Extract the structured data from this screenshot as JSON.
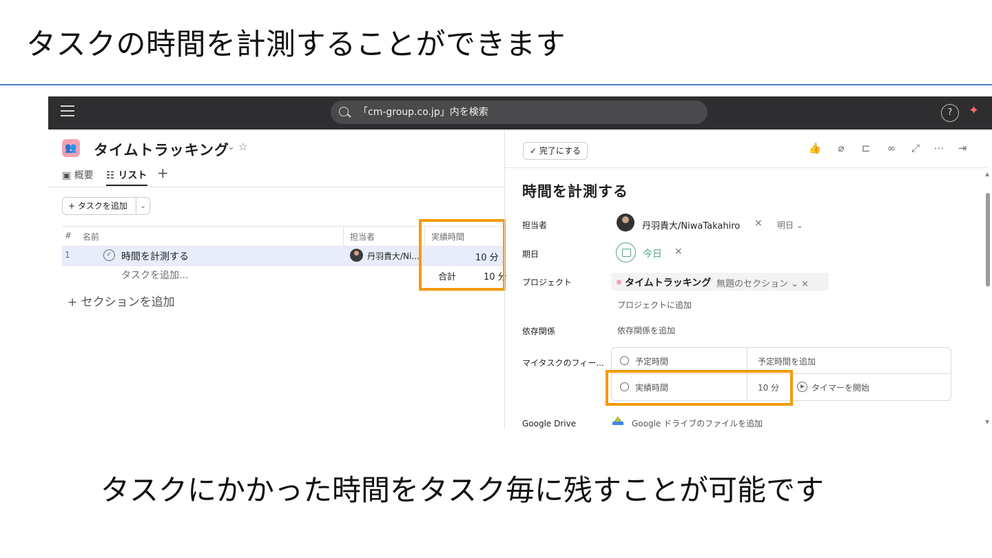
{
  "slide": {
    "title": "タスクの時間を計測することができます",
    "caption": "タスクにかかった時間をタスク毎に残すことが可能です"
  },
  "topbar": {
    "search_text": "「cm-group.co.jp」内を検索",
    "help_label": "?",
    "ai_icon": "sparkle-icon"
  },
  "project": {
    "icon_glyph": "👥",
    "name": "タイムトラッキング",
    "chevron": "⌄",
    "star": "☆",
    "tabs": [
      {
        "label": "概要",
        "icon": "overview-icon"
      },
      {
        "label": "リスト",
        "icon": "list-icon"
      }
    ],
    "tab_add": "+",
    "add_task_button": "+ タスクを追加",
    "add_task_dropdown": "⌄"
  },
  "list": {
    "columns": {
      "num": "#",
      "name": "名前",
      "assignee": "担当者",
      "actual_time": "実績時間"
    },
    "rows": [
      {
        "num": "1",
        "name": "時間を計測する",
        "assignee": "丹羽貴大/Ni...",
        "actual_time": "10 分"
      }
    ],
    "add_task_row": "タスクを追加...",
    "total_label": "合計",
    "total_value": "10 分",
    "add_section": "+ セクションを追加"
  },
  "detail": {
    "complete_button": "✓ 完了にする",
    "toolbar_icons": [
      "like-icon",
      "attachment-icon",
      "subtask-icon",
      "link-icon",
      "expand-icon",
      "more-icon",
      "close-pane-icon"
    ],
    "title": "時間を計測する",
    "fields": {
      "assignee_label": "担当者",
      "assignee_value": "丹羽貴大/NiwaTakahiro",
      "assignee_x": "×",
      "assignee_due": "明日 ⌄",
      "due_label": "期日",
      "due_value": "今日",
      "due_x": "×",
      "project_label": "プロジェクト",
      "project_name": "タイムトラッキング",
      "project_section": "無題のセクション ⌄  ×",
      "project_add": "プロジェクトに追加",
      "dependency_label": "依存関係",
      "dependency_add": "依存関係を追加",
      "mytask_label": "マイタスクのフィー...",
      "estimated_label": "予定時間",
      "estimated_add": "予定時間を追加",
      "actual_label": "実績時間",
      "actual_value": "10 分",
      "timer_button": "タイマーを開始",
      "gdrive_label": "Google Drive",
      "gdrive_add": "Google ドライブのファイルを追加"
    }
  },
  "colors": {
    "highlight": "#f59a0c",
    "topbar": "#2e2e30",
    "due_green": "#58a182",
    "rule": "#4f79c4"
  }
}
